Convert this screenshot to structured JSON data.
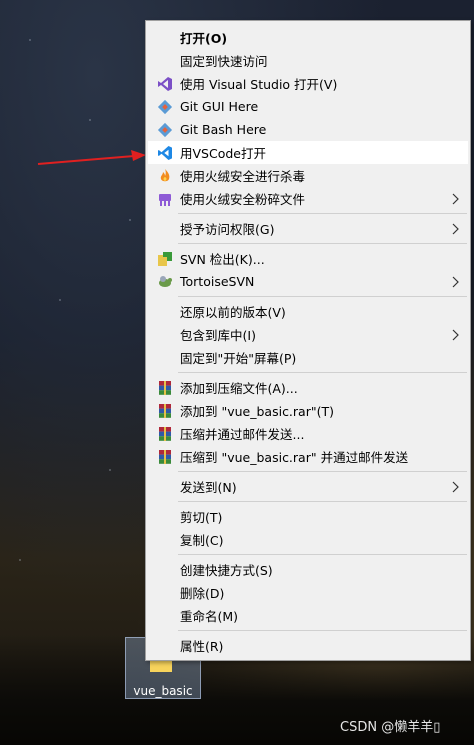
{
  "desktop": {
    "folder_label": "vue_basic",
    "watermark": "CSDN @懒羊羊▯"
  },
  "menu": {
    "items": [
      {
        "label": "打开(O)"
      },
      {
        "label": "固定到快速访问"
      },
      {
        "label": "使用 Visual Studio 打开(V)"
      },
      {
        "label": "Git GUI Here"
      },
      {
        "label": "Git Bash Here"
      },
      {
        "label": "用VSCode打开"
      },
      {
        "label": "使用火绒安全进行杀毒"
      },
      {
        "label": "使用火绒安全粉碎文件"
      },
      {
        "label": "授予访问权限(G)"
      },
      {
        "label": "SVN 检出(K)..."
      },
      {
        "label": "TortoiseSVN"
      },
      {
        "label": "还原以前的版本(V)"
      },
      {
        "label": "包含到库中(I)"
      },
      {
        "label": "固定到\"开始\"屏幕(P)"
      },
      {
        "label": "添加到压缩文件(A)..."
      },
      {
        "label": "添加到 \"vue_basic.rar\"(T)"
      },
      {
        "label": "压缩并通过邮件发送..."
      },
      {
        "label": "压缩到 \"vue_basic.rar\" 并通过邮件发送"
      },
      {
        "label": "发送到(N)"
      },
      {
        "label": "剪切(T)"
      },
      {
        "label": "复制(C)"
      },
      {
        "label": "创建快捷方式(S)"
      },
      {
        "label": "删除(D)"
      },
      {
        "label": "重命名(M)"
      },
      {
        "label": "属性(R)"
      }
    ]
  },
  "colors": {
    "menu_bg": "#f0f0f0",
    "highlight_bg": "#ffffff",
    "arrow": "#e02020",
    "vs_purple": "#7b4fc6",
    "vscode_blue": "#1e88e5",
    "git_blue": "#5b9bd5",
    "huorong_orange": "#f28c1e",
    "huorong_purple": "#8e5bd6",
    "winrar_red": "#b0283a",
    "svn_green": "#3a9a3a"
  }
}
